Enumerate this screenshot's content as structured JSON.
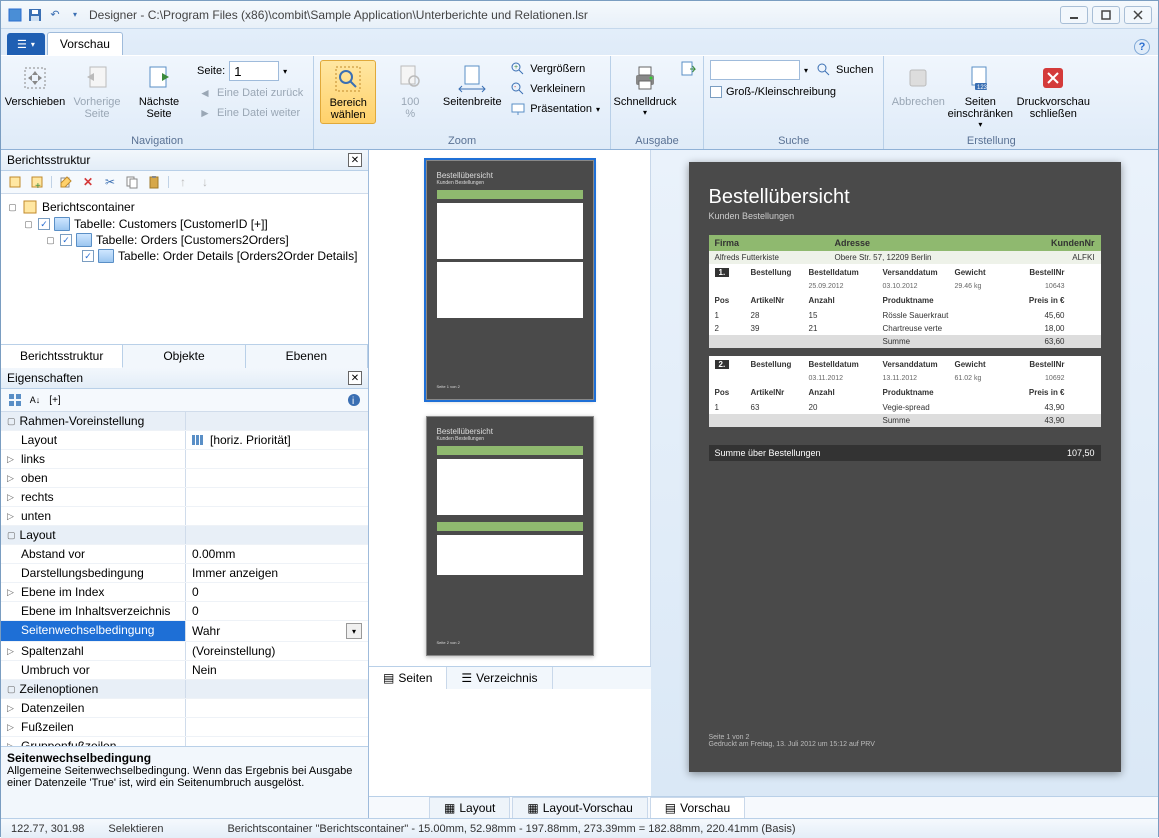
{
  "title": "Designer - C:\\Program Files (x86)\\combit\\Sample Application\\Unterberichte und Relationen.lsr",
  "tabs": {
    "file": "",
    "preview": "Vorschau"
  },
  "ribbon": {
    "nav": {
      "label": "Navigation",
      "move": "Verschieben",
      "prev": "Vorherige\nSeite",
      "next": "Nächste\nSeite",
      "page": "Seite:",
      "pageval": "1",
      "fileback": "Eine Datei zurück",
      "filefwd": "Eine Datei weiter"
    },
    "zoom": {
      "label": "Zoom",
      "area": "Bereich\nwählen",
      "pct": "100\n%",
      "pagewidth": "Seitenbreite",
      "zoomin": "Vergrößern",
      "zoomout": "Verkleinern",
      "present": "Präsentation"
    },
    "output": {
      "label": "Ausgabe",
      "quick": "Schnelldruck"
    },
    "search": {
      "label": "Suche",
      "placeholder": "",
      "btn": "Suchen",
      "case": "Groß-/Kleinschreibung"
    },
    "create": {
      "label": "Erstellung",
      "abort": "Abbrechen",
      "limit": "Seiten\neinschränken",
      "close": "Druckvorschau\nschließen"
    }
  },
  "leftTitle": "Berichtsstruktur",
  "tree": {
    "root": "Berichtscontainer",
    "n1": "Tabelle: Customers [CustomerID [+]]",
    "n2": "Tabelle: Orders [Customers2Orders]",
    "n3": "Tabelle: Order Details [Orders2Order Details]"
  },
  "leftTabs": {
    "a": "Berichtsstruktur",
    "b": "Objekte",
    "c": "Ebenen"
  },
  "propsTitle": "Eigenschaften",
  "props": {
    "cat1": "Rahmen-Voreinstellung",
    "layout": "Layout",
    "layoutv": "[horiz. Priorität]",
    "links": "links",
    "oben": "oben",
    "rechts": "rechts",
    "unten": "unten",
    "cat2": "Layout",
    "abstand": "Abstand vor",
    "abstandv": "0.00mm",
    "darst": "Darstellungsbedingung",
    "darstv": "Immer anzeigen",
    "eidx": "Ebene im Index",
    "eidxv": "0",
    "einh": "Ebene im Inhaltsverzeichnis",
    "einhv": "0",
    "seiten": "Seitenwechselbedingung",
    "seitenv": "Wahr",
    "spalten": "Spaltenzahl",
    "spaltenv": "(Voreinstellung)",
    "umbruch": "Umbruch vor",
    "umbruchv": "Nein",
    "cat3": "Zeilenoptionen",
    "daten": "Datenzeilen",
    "fuss": "Fußzeilen",
    "grfuss": "Gruppenfußzeilen"
  },
  "propDesc": {
    "title": "Seitenwechselbedingung",
    "text": "Allgemeine Seitenwechselbedingung. Wenn das Ergebnis bei Ausgabe einer Datenzeile 'True' ist, wird ein Seitenumbruch ausgelöst."
  },
  "thumbTabs": {
    "pages": "Seiten",
    "index": "Verzeichnis"
  },
  "viewTabs": {
    "layout": "Layout",
    "layoutprev": "Layout-Vorschau",
    "preview": "Vorschau"
  },
  "status": {
    "coords": "122.77, 301.98",
    "mode": "Selektieren",
    "info": "Berichtscontainer \"Berichtscontainer\"  -  15.00mm, 52.98mm  -   197.88mm, 273.39mm   =  182.88mm, 220.41mm (Basis)"
  },
  "report": {
    "title": "Bestellübersicht",
    "sub": "Kunden Bestellungen",
    "hdr": {
      "firma": "Firma",
      "adresse": "Adresse",
      "knr": "KundenNr"
    },
    "cust": {
      "firma": "Alfreds Futterkiste",
      "adresse": "Obere Str. 57, 12209 Berlin",
      "knr": "ALFKI"
    },
    "ord1": {
      "n": "1.",
      "lbl": "Bestellung",
      "bd": "Bestelldatum",
      "bdv": "25.09.2012",
      "vd": "Versanddatum",
      "vdv": "03.10.2012",
      "gw": "Gewicht",
      "gwv": "29.46 kg",
      "bn": "BestellNr",
      "bnv": "10643"
    },
    "cols": {
      "pos": "Pos",
      "art": "ArtikelNr",
      "anz": "Anzahl",
      "prod": "Produktname",
      "preis": "Preis in €"
    },
    "o1r1": {
      "pos": "1",
      "art": "28",
      "anz": "15",
      "prod": "Rössle Sauerkraut",
      "preis": "45,60"
    },
    "o1r2": {
      "pos": "2",
      "art": "39",
      "anz": "21",
      "prod": "Chartreuse verte",
      "preis": "18,00"
    },
    "sum": "Summe",
    "o1sum": "63,60",
    "ord2": {
      "n": "2.",
      "bdv": "03.11.2012",
      "vdv": "13.11.2012",
      "gwv": "61.02 kg",
      "bnv": "10692"
    },
    "o2r1": {
      "pos": "1",
      "art": "63",
      "anz": "20",
      "prod": "Vegie-spread",
      "preis": "43,90"
    },
    "o2sum": "43,90",
    "total": "Summe über Bestellungen",
    "totalv": "107,50",
    "foot1": "Seite 1 von 2",
    "foot2": "Gedruckt am Freitag, 13. Juli 2012 um 15:12 auf PRV"
  }
}
